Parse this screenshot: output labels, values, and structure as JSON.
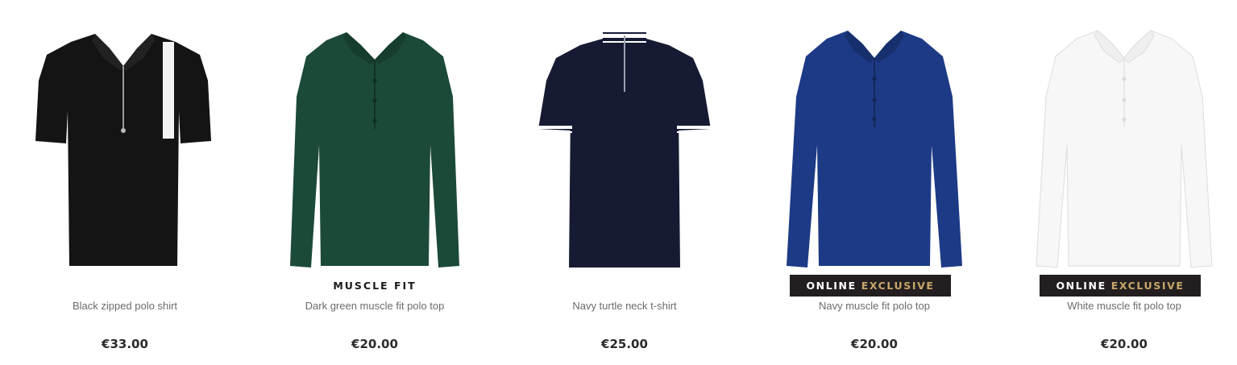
{
  "products": [
    {
      "name": "Black zipped polo shirt",
      "price": "€33.00",
      "color": "#151414",
      "sleeves": "short",
      "badge": ""
    },
    {
      "name": "Dark green muscle fit polo top",
      "price": "€20.00",
      "color": "#1c4a38",
      "sleeves": "long",
      "badge": "MUSCLE FIT"
    },
    {
      "name": "Navy turtle neck t-shirt",
      "price": "€25.00",
      "color": "#161b33",
      "sleeves": "short",
      "badge": ""
    },
    {
      "name": "Navy muscle fit polo top",
      "price": "€20.00",
      "color": "#1d3a86",
      "sleeves": "long",
      "badge_white": "ONLINE",
      "badge_gold": "EXCLUSIVE"
    },
    {
      "name": "White muscle fit polo top",
      "price": "€20.00",
      "color": "#f7f7f7",
      "sleeves": "long",
      "badge_white": "ONLINE",
      "badge_gold": "EXCLUSIVE"
    }
  ]
}
